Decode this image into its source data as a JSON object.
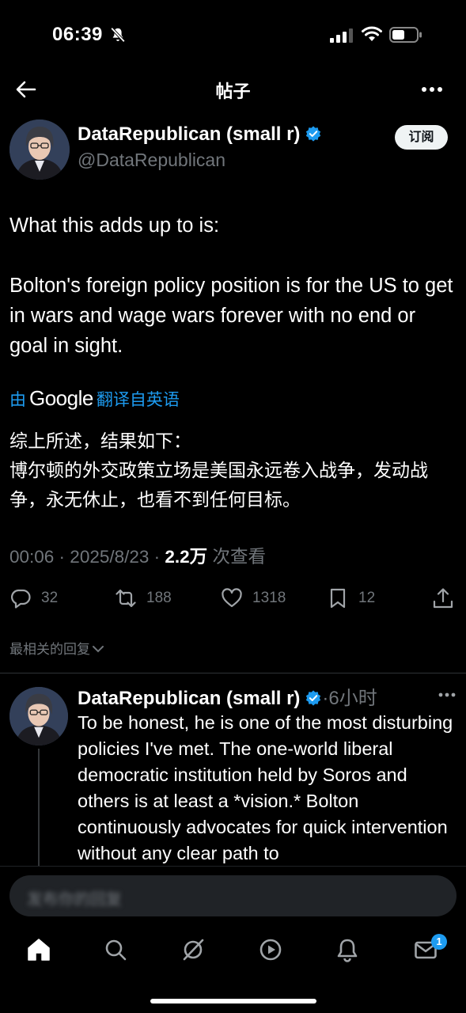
{
  "status_bar": {
    "time": "06:39"
  },
  "header": {
    "title": "帖子"
  },
  "post": {
    "author_name": "DataRepublican (small r)",
    "handle": "@DataRepublican",
    "subscribe_label": "订阅",
    "paragraphs": [
      "What this adds up to is:",
      "Bolton's foreign policy position is for the US to get in wars and wage wars forever with no end or goal in sight."
    ],
    "translate": {
      "prefix": "由",
      "brand": "Google",
      "suffix": "翻译自英语"
    },
    "translated_paragraphs": [
      "综上所述，结果如下：",
      "博尔顿的外交政策立场是美国永远卷入战争，发动战争，永无休止，也看不到任何目标。"
    ],
    "meta": {
      "time_date": "00:06 · 2025/8/23 · ",
      "views": "2.2万",
      "views_label": " 次查看"
    },
    "stats": {
      "replies": "32",
      "reposts": "188",
      "likes": "1318",
      "bookmarks": "12"
    }
  },
  "replies_section": {
    "sort_label": "最相关的回复"
  },
  "reply": {
    "author_name": "DataRepublican (small r)",
    "time": "·6小时",
    "text": "To be honest, he is one of the most disturbing policies I've met. The one-world liberal democratic institution held by Soros and others is at least a *vision.* Bolton continuously advocates for quick intervention without any clear path to"
  },
  "compose": {
    "placeholder": "发布你的回复"
  },
  "tabbar": {
    "messages_badge": "1"
  },
  "colors": {
    "accent": "#1d9bf0",
    "background": "#000000",
    "muted": "#71767b"
  }
}
